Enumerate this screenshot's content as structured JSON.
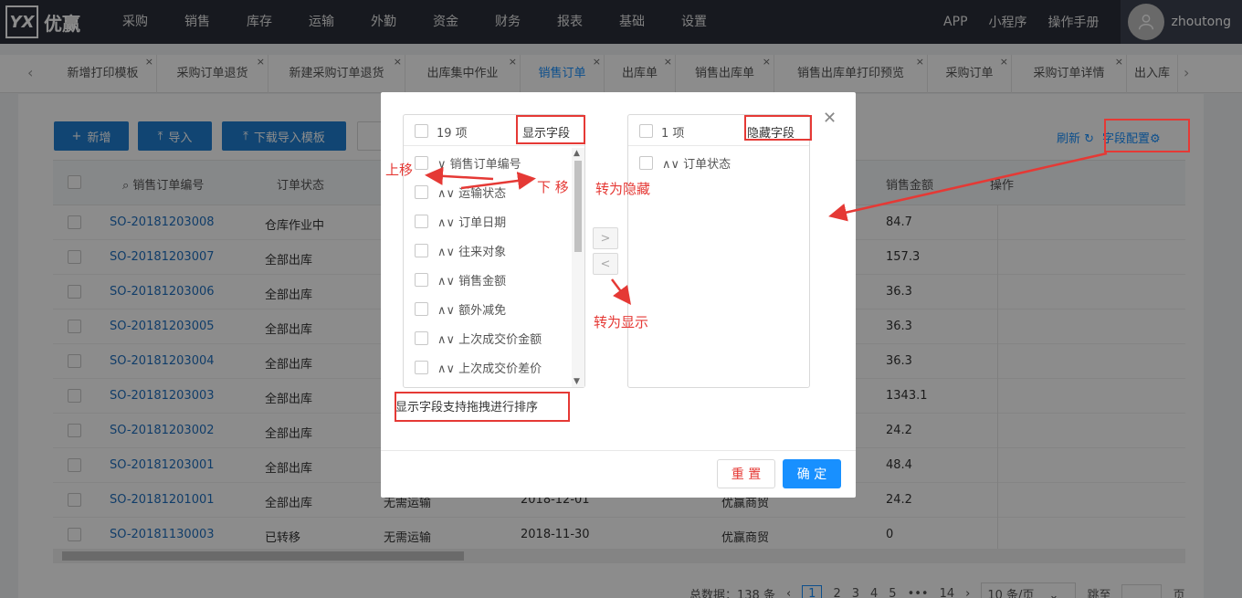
{
  "brand": {
    "logo_mark": "YX",
    "name": "优赢"
  },
  "nav": [
    "采购",
    "销售",
    "库存",
    "运输",
    "外勤",
    "资金",
    "财务",
    "报表",
    "基础",
    "设置"
  ],
  "top_links": [
    "APP",
    "小程序",
    "操作手册"
  ],
  "user": {
    "name": "zhoutong"
  },
  "tabs": [
    "新增打印模板",
    "采购订单退货",
    "新建采购订单退货",
    "出库集中作业",
    "销售订单",
    "出库单",
    "销售出库单",
    "销售出库单打印预览",
    "采购订单",
    "采购订单详情",
    "出入库"
  ],
  "active_tab": "销售订单",
  "toolbar": {
    "add": "新增",
    "import": "导入",
    "download_template": "下载导入模板",
    "refresh": "刷新",
    "field_config": "字段配置"
  },
  "grid": {
    "headers": [
      "销售订单编号",
      "订单状态",
      "销售金额",
      "操作"
    ],
    "rows": [
      {
        "no": "SO-20181203008",
        "status": "仓库作业中",
        "amount": "84.7"
      },
      {
        "no": "SO-20181203007",
        "status": "全部出库",
        "amount": "157.3"
      },
      {
        "no": "SO-20181203006",
        "status": "全部出库",
        "amount": "36.3"
      },
      {
        "no": "SO-20181203005",
        "status": "全部出库",
        "amount": "36.3"
      },
      {
        "no": "SO-20181203004",
        "status": "全部出库",
        "amount": "36.3"
      },
      {
        "no": "SO-20181203003",
        "status": "全部出库",
        "amount": "1343.1"
      },
      {
        "no": "SO-20181203002",
        "status": "全部出库",
        "amount": "24.2"
      },
      {
        "no": "SO-20181203001",
        "status": "全部出库",
        "amount": "48.4"
      },
      {
        "no": "SO-20181201001",
        "status": "全部出库",
        "amount": "24.2",
        "transport": "无需运输",
        "date": "2018-12-01",
        "partner": "优赢商贸"
      },
      {
        "no": "SO-20181130003",
        "status": "已转移",
        "amount": "0",
        "transport": "无需运输",
        "date": "2018-11-30",
        "partner": "优赢商贸"
      }
    ]
  },
  "pagination": {
    "total": "总数据：138 条",
    "pages": [
      "1",
      "2",
      "3",
      "4",
      "5",
      "•••",
      "14"
    ],
    "size": "10 条/页",
    "jump": "跳至",
    "unit": "页"
  },
  "modal": {
    "left": {
      "count": "19 项",
      "title": "显示字段",
      "items": [
        "∨ 销售订单编号",
        "∧∨ 运输状态",
        "∧∨ 订单日期",
        "∧∨ 往来对象",
        "∧∨ 销售金额",
        "∧∨ 额外减免",
        "∧∨ 上次成交价金额",
        "∧∨ 上次成交价差价"
      ]
    },
    "right": {
      "count": "1 项",
      "title": "隐藏字段",
      "items": [
        "∧∨ 订单状态"
      ]
    },
    "to_right": ">",
    "to_left": "<",
    "hint": "显示字段支持拖拽进行排序",
    "reset": "重 置",
    "ok": "确 定"
  },
  "annotations": {
    "up": "上移",
    "down": "下 移",
    "to_hidden": "转为隐藏",
    "to_shown": "转为显示"
  },
  "colors": {
    "nav_bg": "#2b2f3a",
    "primary": "#1890ff",
    "annotation": "#e53935"
  }
}
